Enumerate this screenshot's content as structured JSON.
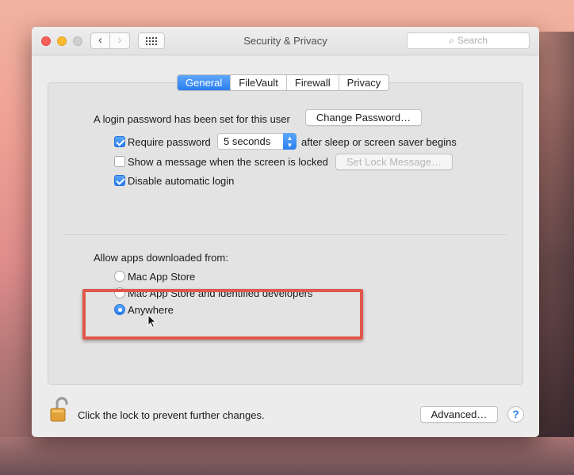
{
  "window": {
    "title": "Security & Privacy",
    "search_placeholder": "Search",
    "nav": {
      "back_glyph": "‹",
      "forward_glyph": "›"
    }
  },
  "tabs": [
    {
      "label": "General",
      "active": true
    },
    {
      "label": "FileVault",
      "active": false
    },
    {
      "label": "Firewall",
      "active": false
    },
    {
      "label": "Privacy",
      "active": false
    }
  ],
  "general": {
    "login_text": "A login password has been set for this user",
    "change_password_label": "Change Password…",
    "require_password": {
      "checked": true,
      "label": "Require password",
      "select_value": "5 seconds",
      "suffix": "after sleep or screen saver begins"
    },
    "show_message": {
      "checked": false,
      "label": "Show a message when the screen is locked",
      "button_label": "Set Lock Message…"
    },
    "disable_auto_login": {
      "checked": true,
      "label": "Disable automatic login"
    }
  },
  "allow_apps": {
    "heading": "Allow apps downloaded from:",
    "options": [
      {
        "label": "Mac App Store",
        "selected": false
      },
      {
        "label": "Mac App Store and identified developers",
        "selected": false
      },
      {
        "label": "Anywhere",
        "selected": true
      }
    ]
  },
  "footer": {
    "lock_text": "Click the lock to prevent further changes.",
    "advanced_label": "Advanced…",
    "help_label": "?"
  },
  "colors": {
    "accent": "#2c7ff0",
    "highlight_box": "#e0574c"
  },
  "icons": [
    "search-icon",
    "padlock-open-icon",
    "mouse-pointer-icon",
    "grid-icon",
    "chevron-down-icon"
  ]
}
